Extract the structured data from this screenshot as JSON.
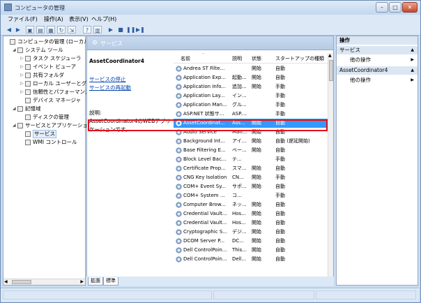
{
  "window": {
    "title": "コンピュータの管理"
  },
  "menu": [
    "ファイル(F)",
    "操作(A)",
    "表示(V)",
    "ヘルプ(H)"
  ],
  "tree": [
    {
      "label": "コンピュータの管理 (ローカル)",
      "level": 0,
      "exp": ""
    },
    {
      "label": "システム ツール",
      "level": 1,
      "exp": "◢"
    },
    {
      "label": "タスク スケジューラ",
      "level": 2,
      "exp": "▷"
    },
    {
      "label": "イベント ビューア",
      "level": 2,
      "exp": "▷"
    },
    {
      "label": "共有フォルダ",
      "level": 2,
      "exp": "▷"
    },
    {
      "label": "ローカル ユーザーとグループ",
      "level": 2,
      "exp": "▷"
    },
    {
      "label": "信頼性とパフォーマンス",
      "level": 2,
      "exp": "▷"
    },
    {
      "label": "デバイス マネージャ",
      "level": 2,
      "exp": ""
    },
    {
      "label": "記憶域",
      "level": 1,
      "exp": "◢"
    },
    {
      "label": "ディスクの管理",
      "level": 2,
      "exp": ""
    },
    {
      "label": "サービスとアプリケーション",
      "level": 1,
      "exp": "◢"
    },
    {
      "label": "サービス",
      "level": 2,
      "exp": "",
      "sel": true
    },
    {
      "label": "WMI コントロール",
      "level": 2,
      "exp": ""
    }
  ],
  "services_header": "サービス",
  "desc": {
    "name": "AssetCoordinator4",
    "stop_link": "サービスの停止",
    "restart_link": "サービスの再起動",
    "label": "説明:",
    "text": "AssetCoordinator4のWEBアプリケーションです。"
  },
  "columns": [
    "名前",
    "説明",
    "状態",
    "スタートアップの種類"
  ],
  "rows": [
    {
      "name": "Andrea ST Filte...",
      "desc": "",
      "status": "開始",
      "startup": "自動"
    },
    {
      "name": "Application Exp...",
      "desc": "起動...",
      "status": "開始",
      "startup": "自動"
    },
    {
      "name": "Application Info...",
      "desc": "追加...",
      "status": "開始",
      "startup": "手動"
    },
    {
      "name": "Application Lay...",
      "desc": "イン...",
      "status": "",
      "startup": "手動"
    },
    {
      "name": "Application Man...",
      "desc": "グル...",
      "status": "",
      "startup": "手動"
    },
    {
      "name": "ASP.NET 状態サ...",
      "desc": "ASP....",
      "status": "",
      "startup": "手動"
    },
    {
      "name": "AssetCoordinat...",
      "desc": "Ass...",
      "status": "開始",
      "startup": "自動",
      "sel": true
    },
    {
      "name": "Audio Service",
      "desc": "Man...",
      "status": "開始",
      "startup": "自動"
    },
    {
      "name": "Background Int...",
      "desc": "アイ...",
      "status": "開始",
      "startup": "自動 (遅延開始)"
    },
    {
      "name": "Base Filtering E...",
      "desc": "ベー...",
      "status": "開始",
      "startup": "自動"
    },
    {
      "name": "Block Level Bac...",
      "desc": "テ...",
      "status": "",
      "startup": "手動"
    },
    {
      "name": "Certificate Prop...",
      "desc": "スマ...",
      "status": "開始",
      "startup": "自動"
    },
    {
      "name": "CNG Key Isolation",
      "desc": "CN...",
      "status": "開始",
      "startup": "手動"
    },
    {
      "name": "COM+ Event Sy...",
      "desc": "サポ...",
      "status": "開始",
      "startup": "自動"
    },
    {
      "name": "COM+ System ...",
      "desc": "コ...",
      "status": "",
      "startup": "手動"
    },
    {
      "name": "Computer Brow...",
      "desc": "ネッ...",
      "status": "開始",
      "startup": "自動"
    },
    {
      "name": "Credential Vault...",
      "desc": "Hos...",
      "status": "開始",
      "startup": "自動"
    },
    {
      "name": "Credential Vault...",
      "desc": "Hos...",
      "status": "開始",
      "startup": "自動"
    },
    {
      "name": "Cryptographic S...",
      "desc": "デジ...",
      "status": "開始",
      "startup": "自動"
    },
    {
      "name": "DCOM Server P...",
      "desc": "DC...",
      "status": "開始",
      "startup": "自動"
    },
    {
      "name": "Dell ControlPoin...",
      "desc": "This...",
      "status": "開始",
      "startup": "自動"
    },
    {
      "name": "Dell ControlPoin...",
      "desc": "Dell...",
      "status": "開始",
      "startup": "自動"
    }
  ],
  "tabs": [
    "拡張",
    "標準"
  ],
  "actions": {
    "header": "操作",
    "groups": [
      {
        "title": "サービス",
        "item": "他の操作"
      },
      {
        "title": "AssetCoordinator4",
        "item": "他の操作"
      }
    ]
  }
}
